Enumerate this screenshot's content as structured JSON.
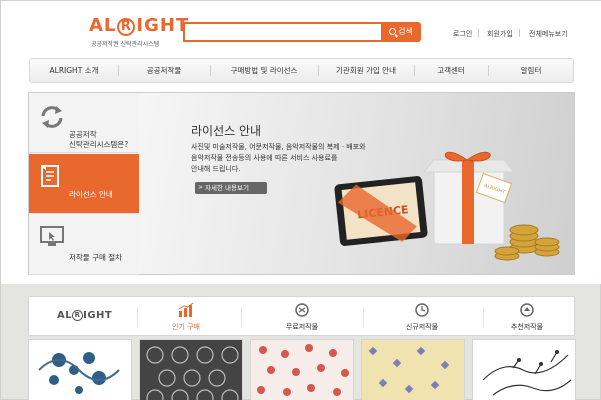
{
  "header": {
    "logo_text": "AL",
    "logo_ring": "R",
    "logo_text2": "IGHT",
    "logo_subtitle": "공공저작권 신탁관리시스템",
    "search": {
      "value": "",
      "placeholder": "",
      "button_label": "검색"
    },
    "util_links": [
      "로그인",
      "회원가입",
      "전체메뉴보기"
    ]
  },
  "nav": {
    "items": [
      "ALRIGHT 소개",
      "공공저작물",
      "구매방법 및 라이선스",
      "기관회원 가입 안내",
      "고객센터",
      "알림터"
    ]
  },
  "banner": {
    "side_items": [
      {
        "label1": "공공저작",
        "label2": "신탁관리시스템은?",
        "icon": "refresh-icon"
      },
      {
        "label1": "라이선스 안내",
        "label2": "",
        "icon": "document-icon"
      },
      {
        "label1": "저작물 구매 절차",
        "label2": "",
        "icon": "monitor-icon"
      }
    ],
    "hero": {
      "title": "라이선스 안내",
      "desc1": "사진및 미술저작물, 어문저작물, 음악저작물의 복제 · 배포와",
      "desc2": "음악저작물 전송등의 사용에 따른 서비스 사용료를",
      "desc3": "안내해 드립니다.",
      "button_label": "자세한 내용보기",
      "licence_label": "LICENCE",
      "tag_label": "ALRIGHT"
    }
  },
  "tabs": {
    "logo_text": "AL",
    "logo_ring": "R",
    "logo_text2": "IGHT",
    "items": [
      {
        "label": "인기 구매",
        "icon": "bar-chart-icon"
      },
      {
        "label": "무료저작물",
        "icon": "free-icon"
      },
      {
        "label": "신규저작물",
        "icon": "clock-icon"
      },
      {
        "label": "추천저작물",
        "icon": "recommend-icon"
      }
    ]
  },
  "colors": {
    "accent": "#e8682d",
    "background": "#e4e4e0"
  }
}
